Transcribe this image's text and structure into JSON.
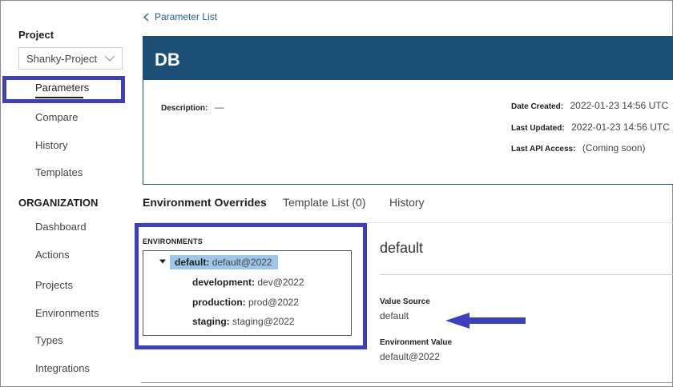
{
  "breadcrumb": {
    "label": "Parameter List"
  },
  "sidebar": {
    "project_heading": "Project",
    "project_select": {
      "value": "Shanky-Project"
    },
    "project_items": [
      {
        "label": "Parameters",
        "active": true
      },
      {
        "label": "Compare"
      },
      {
        "label": "History"
      },
      {
        "label": "Templates"
      }
    ],
    "org_heading": "ORGANIZATION",
    "org_items": [
      {
        "label": "Dashboard"
      },
      {
        "label": "Actions"
      },
      {
        "label": "Projects"
      },
      {
        "label": "Environments"
      },
      {
        "label": "Types"
      },
      {
        "label": "Integrations"
      }
    ]
  },
  "parameter": {
    "name": "DB",
    "description_label": "Description:",
    "description_value": "—",
    "date_created_label": "Date Created:",
    "date_created_value": "2022-01-23 14:56 UTC",
    "last_updated_label": "Last Updated:",
    "last_updated_value": "2022-01-23 14:56 UTC",
    "last_api_label": "Last API Access:",
    "last_api_value": "(Coming soon)"
  },
  "tabs": [
    {
      "label": "Environment Overrides",
      "active": true
    },
    {
      "label": "Template List (0)"
    },
    {
      "label": "History"
    }
  ],
  "environments": {
    "heading": "ENVIRONMENTS",
    "items": [
      {
        "key": "default:",
        "value": "default@2022",
        "selected": true
      },
      {
        "key": "development:",
        "value": "dev@2022"
      },
      {
        "key": "production:",
        "value": "prod@2022"
      },
      {
        "key": "staging:",
        "value": "staging@2022"
      }
    ]
  },
  "detail": {
    "title": "default",
    "value_source_label": "Value Source",
    "value_source": "default",
    "environment_value_label": "Environment Value",
    "environment_value": "default@2022"
  },
  "colors": {
    "header_band": "#1c4f75",
    "annotation": "#3e3fbf",
    "selected_env": "#9cc7ea",
    "link": "#1f5ea8"
  },
  "icons": {
    "breadcrumb": "chevron-left-icon",
    "select": "chevron-down-icon",
    "tree_toggle": "caret-down-icon",
    "annotation_arrow": "arrow-left-icon"
  }
}
